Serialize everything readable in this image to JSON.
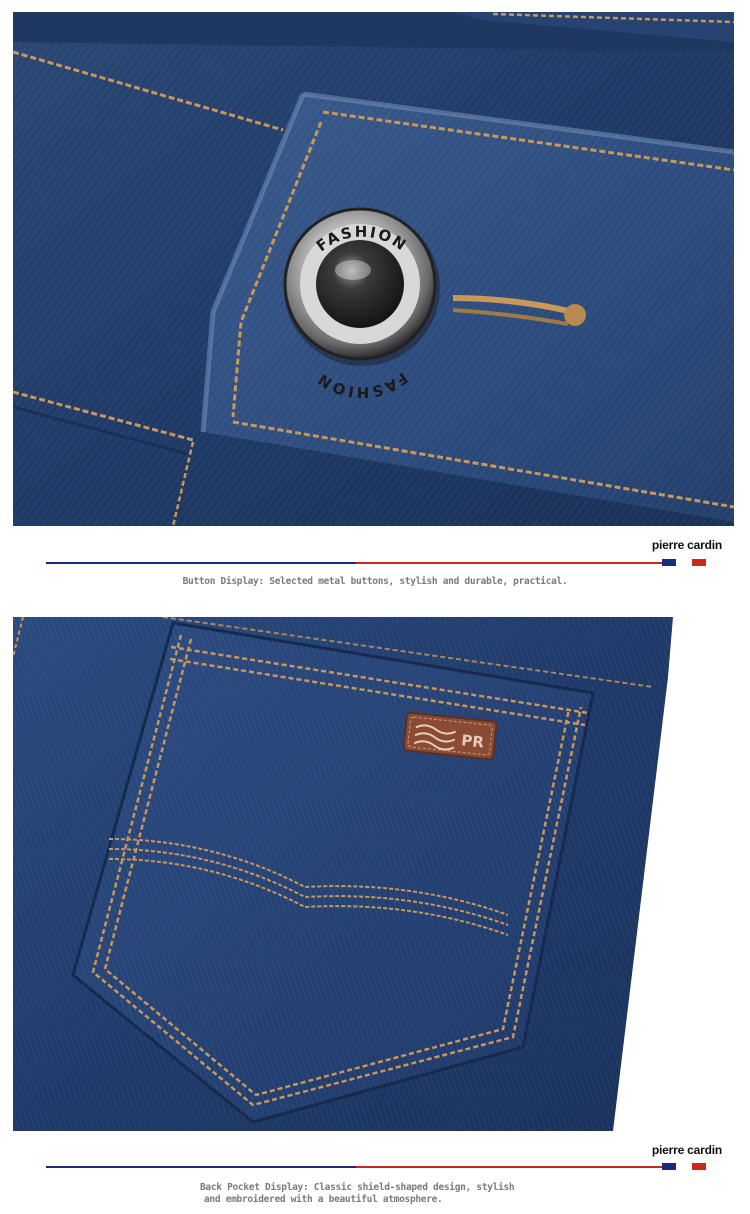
{
  "sections": [
    {
      "id": "button",
      "button_text": "FASHION",
      "brand": "pierre cardin",
      "caption": "Button Display: Selected metal buttons, stylish and durable, practical."
    },
    {
      "id": "pocket",
      "patch_text": "PR",
      "brand": "pierre cardin",
      "caption_line1": "Back Pocket Display: Classic shield-shaped design, stylish",
      "caption_line2": "and embroidered with a beautiful atmosphere."
    }
  ],
  "colors": {
    "denim_dark": "#1c3560",
    "denim_mid": "#2e4d80",
    "stitch": "#c8975a",
    "accent_blue": "#1d2a78",
    "accent_red": "#c8281e",
    "caption": "#7a7a7a"
  }
}
